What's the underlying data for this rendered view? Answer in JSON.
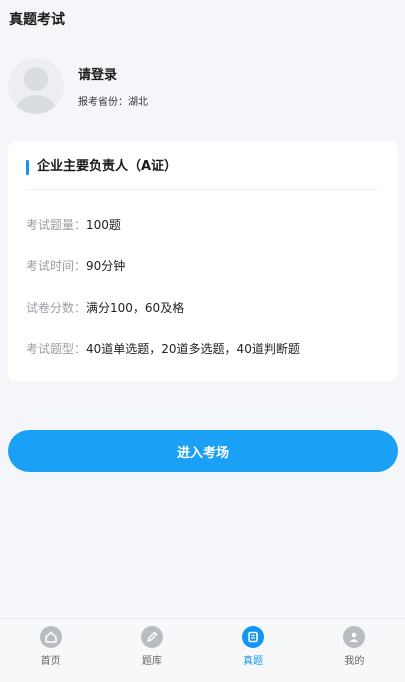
{
  "header": {
    "title": "真题考试"
  },
  "profile": {
    "login_text": "请登录",
    "province_label": "报考省份：",
    "province_value": "湖北"
  },
  "exam": {
    "title": "企业主要负责人（A证）",
    "rows": [
      {
        "label": "考试题量：",
        "value": "100题"
      },
      {
        "label": "考试时间：",
        "value": "90分钟"
      },
      {
        "label": "试卷分数：",
        "value": "满分100，60及格"
      },
      {
        "label": "考试题型：",
        "value": "40道单选题，20道多选题，40道判断题"
      }
    ]
  },
  "actions": {
    "enter_label": "进入考场"
  },
  "tabbar": {
    "active_index": 2,
    "items": [
      {
        "label": "首页",
        "icon": "home-icon"
      },
      {
        "label": "题库",
        "icon": "pencil-icon"
      },
      {
        "label": "真题",
        "icon": "document-icon"
      },
      {
        "label": "我的",
        "icon": "user-icon"
      }
    ]
  },
  "colors": {
    "accent": "#1296f2",
    "button": "#1aa0f5"
  }
}
